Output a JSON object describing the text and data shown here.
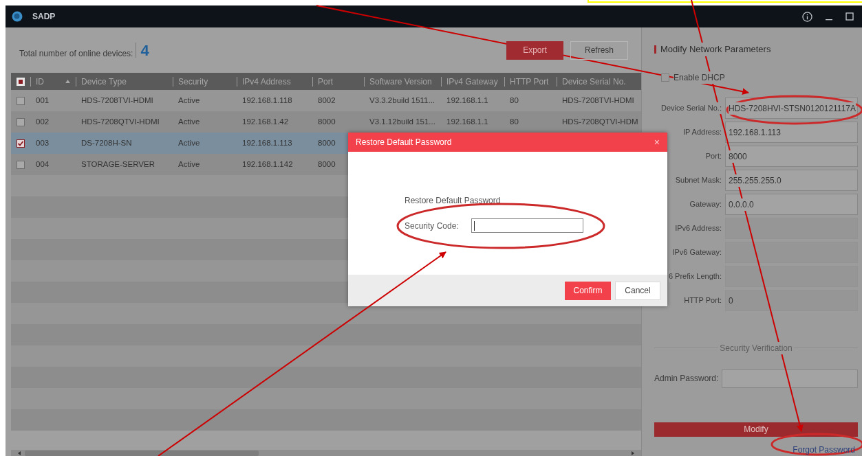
{
  "window": {
    "title": "SADP"
  },
  "toolbar": {
    "total_label": "Total number of online devices:",
    "total_count": "4",
    "buttons": [
      {
        "label": "Export",
        "kind": "primary"
      },
      {
        "label": "Refresh",
        "kind": "secondary"
      }
    ]
  },
  "table": {
    "header_checkbox": {
      "indeterminate": true
    },
    "columns": [
      {
        "label": "ID",
        "sorted": true
      },
      {
        "label": "Device Type",
        "sorted": false
      },
      {
        "label": "Security",
        "sorted": false
      },
      {
        "label": "IPv4 Address",
        "sorted": false
      },
      {
        "label": "Port",
        "sorted": false
      },
      {
        "label": "Software Version",
        "sorted": false
      },
      {
        "label": "IPv4 Gateway",
        "sorted": false
      },
      {
        "label": "HTTP Port",
        "sorted": false
      },
      {
        "label": "Device Serial No.",
        "sorted": false
      }
    ],
    "rows": [
      {
        "selected": false,
        "cells": [
          "001",
          "HDS-7208TVI-HDMI",
          "Active",
          "192.168.1.118",
          "8002",
          "V3.3.2build 1511...",
          "192.168.1.1",
          "80",
          "HDS-7208TVI-HDMI"
        ]
      },
      {
        "selected": false,
        "cells": [
          "002",
          "HDS-7208QTVI-HDMI",
          "Active",
          "192.168.1.42",
          "8000",
          "V3.1.12build 151...",
          "192.168.1.1",
          "80",
          "HDS-7208QTVI-HDM"
        ]
      },
      {
        "selected": true,
        "cells": [
          "003",
          "DS-7208H-SN",
          "Active",
          "192.168.1.113",
          "8000"
        ]
      },
      {
        "selected": false,
        "cells": [
          "004",
          "STORAGE-SERVER",
          "Active",
          "192.168.1.142",
          "8000"
        ]
      }
    ]
  },
  "side_panel": {
    "title": "Modify Network Parameters",
    "enable_dhcp": {
      "label": "Enable DHCP",
      "checked": false
    },
    "fields": [
      {
        "label": "Device Serial No.:",
        "value": "HDS-7208HVI-STSN0120121117A",
        "disabled": false
      },
      {
        "label": "IP Address:",
        "value": "192.168.1.113",
        "disabled": false
      },
      {
        "label": "Port:",
        "value": "8000",
        "disabled": false
      },
      {
        "label": "Subnet Mask:",
        "value": "255.255.255.0",
        "disabled": false
      },
      {
        "label": "Gateway:",
        "value": "0.0.0.0",
        "disabled": false
      },
      {
        "label": "IPv6 Address:",
        "disabled": true
      },
      {
        "label": "IPv6 Gateway:",
        "disabled": true
      },
      {
        "label": "6 Prefix Length:",
        "disabled": true
      },
      {
        "label": "HTTP Port:",
        "value": "0",
        "disabled": true
      }
    ],
    "section_title": "Security Verification",
    "admin_password_label": "Admin Password:",
    "modify_button": "Modify",
    "forgot_password_link": "Forgot Password"
  },
  "dialog": {
    "title": "Restore Default Password",
    "close": "×",
    "heading": "Restore Default Password",
    "security_code_label": "Security Code:",
    "buttons": [
      {
        "label": "Confirm",
        "kind": "primary"
      },
      {
        "label": "Cancel",
        "kind": "secondary"
      }
    ]
  }
}
